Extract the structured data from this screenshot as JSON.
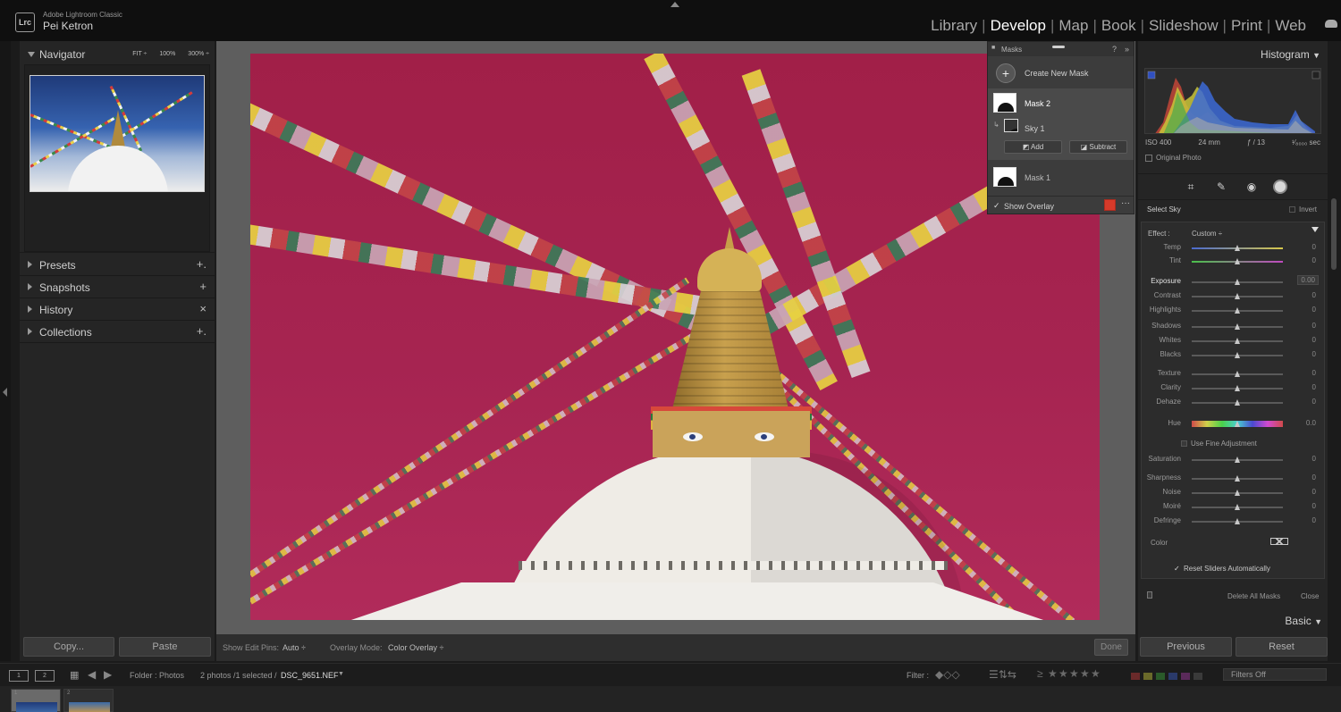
{
  "app": {
    "logo": "Lrc",
    "product": "Adobe Lightroom Classic",
    "user": "Pei Ketron",
    "modules": [
      "Library",
      "Develop",
      "Map",
      "Book",
      "Slideshow",
      "Print",
      "Web"
    ],
    "active_module": "Develop"
  },
  "left_panel": {
    "navigator": {
      "title": "Navigator",
      "zoom": [
        "FIT ÷",
        "100%",
        "300% ÷"
      ]
    },
    "sections": [
      {
        "label": "Presets",
        "action": "+."
      },
      {
        "label": "Snapshots",
        "action": "+"
      },
      {
        "label": "History",
        "action": "×"
      },
      {
        "label": "Collections",
        "action": "+."
      }
    ],
    "copy_label": "Copy...",
    "paste_label": "Paste"
  },
  "masks_panel": {
    "title": "Masks",
    "create_label": "Create New Mask",
    "masks": [
      {
        "name": "Mask 2",
        "components": [
          "Sky 1"
        ]
      },
      {
        "name": "Mask 1",
        "components": []
      }
    ],
    "add_label": "Add",
    "subtract_label": "Subtract",
    "show_overlay_label": "Show Overlay",
    "overlay_color": "#d63a2a"
  },
  "center_toolbar": {
    "edit_pins_label": "Show Edit Pins:",
    "edit_pins_value": "Auto ÷",
    "overlay_mode_label": "Overlay Mode:",
    "overlay_mode_value": "Color Overlay ÷",
    "done_label": "Done"
  },
  "right_panel": {
    "histogram_title": "Histogram",
    "hist_info": [
      "ISO 400",
      "24 mm",
      "ƒ / 13",
      "¹⁄₈₀₀₀ sec"
    ],
    "original_photo_label": "Original Photo",
    "select_label": "Select Sky",
    "invert_label": "Invert",
    "effect_label": "Effect :",
    "effect_value": "Custom ÷",
    "sliders": [
      {
        "name": "Temp",
        "value": "0",
        "gradient": "temp"
      },
      {
        "name": "Tint",
        "value": "0",
        "gradient": "tint"
      },
      {
        "name": "Exposure",
        "value": "0.00",
        "highlighted": true
      },
      {
        "name": "Contrast",
        "value": "0"
      },
      {
        "name": "Highlights",
        "value": "0"
      },
      {
        "name": "Shadows",
        "value": "0"
      },
      {
        "name": "Whites",
        "value": "0"
      },
      {
        "name": "Blacks",
        "value": "0"
      },
      {
        "name": "Texture",
        "value": "0"
      },
      {
        "name": "Clarity",
        "value": "0"
      },
      {
        "name": "Dehaze",
        "value": "0"
      },
      {
        "name": "Hue",
        "value": "0.0",
        "gradient": "hue"
      },
      {
        "name": "Saturation",
        "value": "0"
      },
      {
        "name": "Sharpness",
        "value": "0"
      },
      {
        "name": "Noise",
        "value": "0"
      },
      {
        "name": "Moiré",
        "value": "0"
      },
      {
        "name": "Defringe",
        "value": "0"
      }
    ],
    "fine_adjustment_label": "Use Fine Adjustment",
    "color_label": "Color",
    "reset_sliders_label": "Reset Sliders Automatically",
    "delete_all_label": "Delete All Masks",
    "close_label": "Close",
    "basic_label": "Basic",
    "previous_label": "Previous",
    "reset_label": "Reset"
  },
  "filmstrip": {
    "screen1": "1",
    "screen2": "2",
    "folder_label": "Folder : Photos",
    "selection_info": "2 photos /1 selected /",
    "filename": "DSC_9651.NEF",
    "filter_label": "Filter :",
    "filters_value": "Filters Off",
    "cell_numbers": [
      "1",
      "2"
    ]
  }
}
